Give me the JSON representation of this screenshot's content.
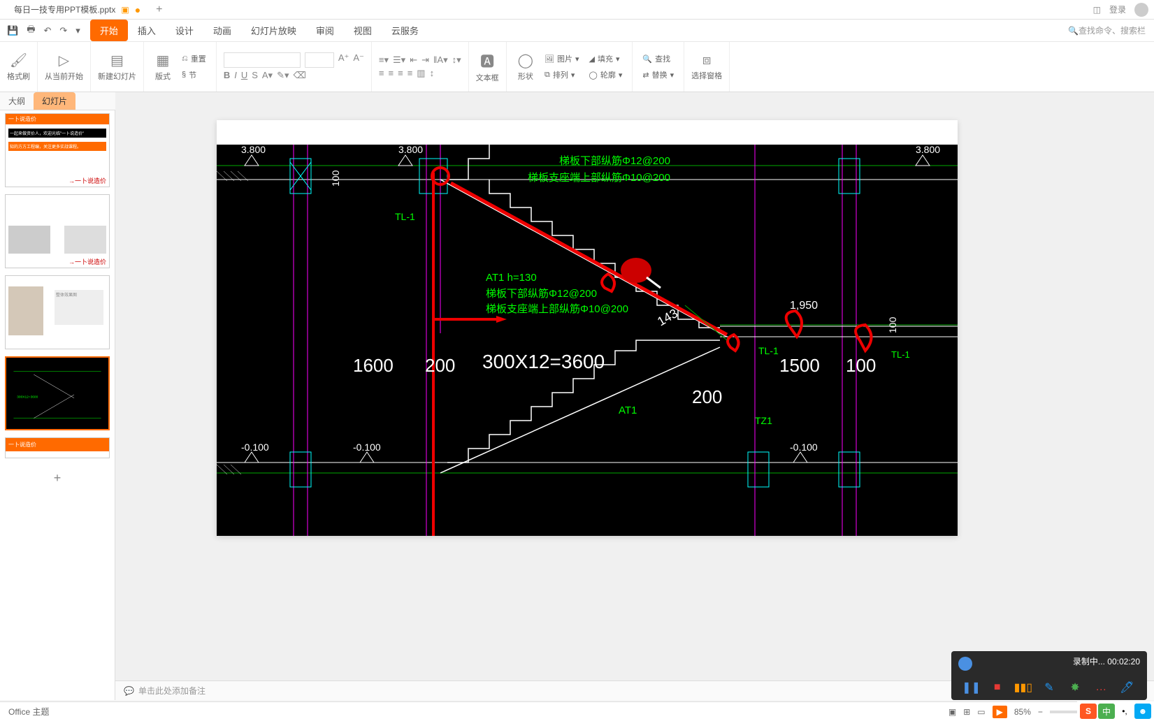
{
  "title_tab": "每日一技专用PPT模板.pptx",
  "login_label": "登录",
  "menu": {
    "start": "开始",
    "tabs": [
      "插入",
      "设计",
      "动画",
      "幻灯片放映",
      "审阅",
      "视图",
      "云服务"
    ]
  },
  "search_placeholder": "查找命令、搜索栏",
  "ribbon": {
    "format_painter": "格式刷",
    "play_from_current": "从当前开始",
    "new_slide": "新建幻灯片",
    "layout": "版式",
    "reset": "重置",
    "section": "节",
    "textbox": "文本框",
    "shapes": "形状",
    "picture": "图片",
    "arrange": "排列",
    "fill": "填充",
    "outline": "轮廓",
    "find": "查找",
    "replace": "替换",
    "select_pane": "选择窗格"
  },
  "left_tabs": {
    "outline": "大纲",
    "slides": "幻灯片"
  },
  "thumbs": {
    "t1_title": "一卜说造价",
    "t1_sub1": "一起来做资价人，欢迎光临\"一卜说造价\"",
    "t1_sub2": "知的方方工程编，关注更多实战课程。",
    "t1_footer": "→一卜说造价",
    "t2_footer": "→一卜说造价",
    "t3_label": "整体效果图",
    "t5_title": "一卜说造价"
  },
  "cad": {
    "elev_top_left": "3.800",
    "elev_top_left2": "3.800",
    "elev_top_right": "3.800",
    "elev_bot_left": "-0.100",
    "elev_bot_left2": "-0.100",
    "elev_bot_right": "-0.100",
    "tl1": "TL-1",
    "tl1_r": "TL-1",
    "tl1_r2": "TL-1",
    "tz1": "TZ1",
    "at1_label": "AT1   h=130",
    "at1_lower": "AT1",
    "rebar1": "梯板下部纵筋Φ12@200",
    "rebar2": "梯板支座端上部纵筋Φ10@200",
    "rebar1_top": "梯板下部纵筋Φ12@200",
    "rebar2_top": "梯板支座端上部纵筋Φ10@200",
    "dim_1600": "1600",
    "dim_200": "200",
    "dim_200_r": "200",
    "dim_formula": "300X12=3600",
    "dim_1500": "1500",
    "dim_100": "100",
    "dim_143": "143",
    "dim_1950": "1,950",
    "dim_100_v": "100",
    "dim_100_v2": "100"
  },
  "notes_placeholder": "单击此处添加备注",
  "status": {
    "theme": "Office 主题",
    "zoom": "85%"
  },
  "recording": {
    "label": "录制中...",
    "time": "00:02:20"
  },
  "ime": {
    "s": "S",
    "cn": "中",
    "sym": "☻"
  }
}
